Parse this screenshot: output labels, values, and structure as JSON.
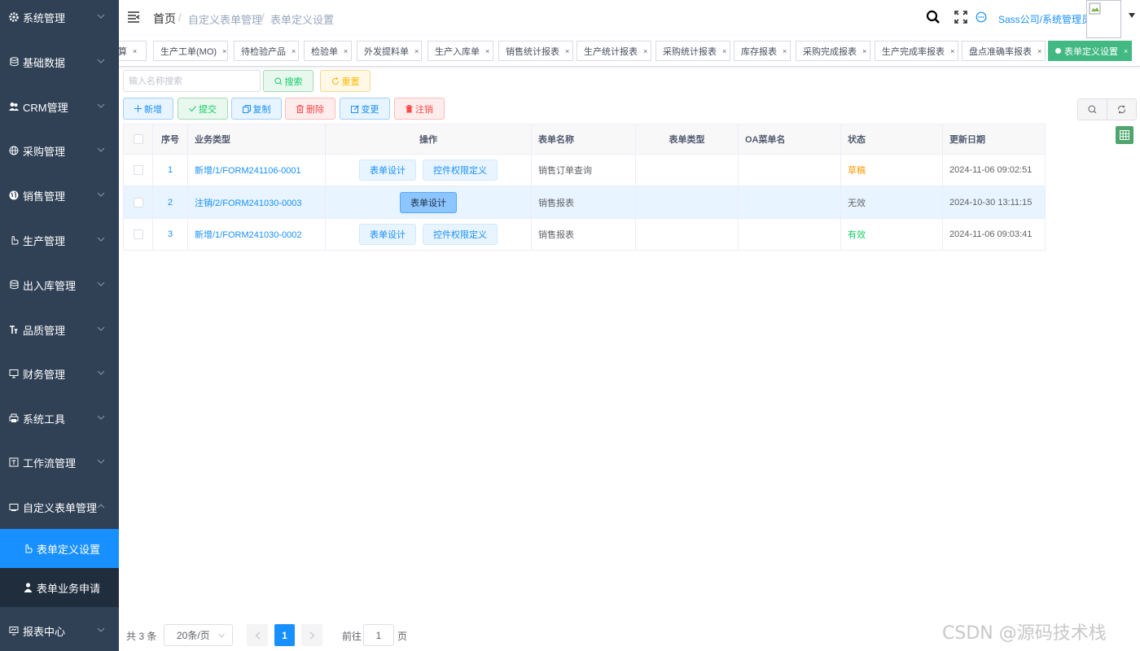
{
  "sidebar": {
    "items": [
      {
        "label": "系统管理",
        "icon": "gear-icon"
      },
      {
        "label": "基础数据",
        "icon": "database-icon"
      },
      {
        "label": "CRM管理",
        "icon": "user-group-icon"
      },
      {
        "label": "采购管理",
        "icon": "globe-icon"
      },
      {
        "label": "销售管理",
        "icon": "globe-filled-icon"
      },
      {
        "label": "生产管理",
        "icon": "hand-icon"
      },
      {
        "label": "出入库管理",
        "icon": "database-icon"
      },
      {
        "label": "品质管理",
        "icon": "text-size-icon"
      },
      {
        "label": "财务管理",
        "icon": "monitor-icon"
      },
      {
        "label": "系统工具",
        "icon": "printer-icon"
      },
      {
        "label": "工作流管理",
        "icon": "workflow-icon"
      },
      {
        "label": "自定义表单管理",
        "icon": "form-icon"
      },
      {
        "label": "报表中心",
        "icon": "report-icon"
      }
    ],
    "sub_items": [
      {
        "label": "表单定义设置",
        "icon": "hand-icon"
      },
      {
        "label": "表单业务申请",
        "icon": "person-icon"
      }
    ]
  },
  "header": {
    "breadcrumb": [
      "首页",
      "自定义表单管理",
      "表单定义设置"
    ],
    "separator": "/",
    "user": "Sass公司/系统管理员"
  },
  "tags": [
    {
      "label": "算"
    },
    {
      "label": "生产工单(MO)"
    },
    {
      "label": "待检验产品"
    },
    {
      "label": "检验单"
    },
    {
      "label": "外发提料单"
    },
    {
      "label": "生产入库单"
    },
    {
      "label": "销售统计报表"
    },
    {
      "label": "生产统计报表"
    },
    {
      "label": "采购统计报表"
    },
    {
      "label": "库存报表"
    },
    {
      "label": "采购完成报表"
    },
    {
      "label": "生产完成率报表"
    },
    {
      "label": "盘点准确率报表"
    },
    {
      "label": "表单定义设置",
      "active": true
    }
  ],
  "tag_close": "×",
  "search": {
    "placeholder": "输入名称搜索",
    "search_label": "搜索",
    "reset_label": "重置"
  },
  "toolbar": {
    "add": "新增",
    "submit": "提交",
    "copy": "复制",
    "delete": "删除",
    "change": "变更",
    "cancel": "注销"
  },
  "table": {
    "columns": [
      "序号",
      "业务类型",
      "操作",
      "表单名称",
      "表单类型",
      "OA菜单名",
      "状态",
      "更新日期"
    ],
    "op_design": "表单设计",
    "op_perm": "控件权限定义",
    "rows": [
      {
        "idx": "1",
        "biz": "新增/1/FORM241106-0001",
        "ops": [
          "表单设计",
          "控件权限定义"
        ],
        "name": "销售订单查询",
        "type": "",
        "oa": "",
        "status": "草稿",
        "status_color": "#ff9900",
        "date": "2024-11-06 09:02:51"
      },
      {
        "idx": "2",
        "biz": "注销/2/FORM241030-0003",
        "ops": [
          "表单设计"
        ],
        "name": "销售报表",
        "type": "",
        "oa": "",
        "status": "无效",
        "status_color": "#606266",
        "date": "2024-10-30 13:11:15"
      },
      {
        "idx": "3",
        "biz": "新增/1/FORM241030-0002",
        "ops": [
          "表单设计",
          "控件权限定义"
        ],
        "name": "销售报表",
        "type": "",
        "oa": "",
        "status": "有效",
        "status_color": "#13ce66",
        "date": "2024-11-06 09:03:41"
      }
    ]
  },
  "pagination": {
    "total": "共 3 条",
    "page_size": "20条/页",
    "current": "1",
    "goto_label": "前往",
    "goto_value": "1",
    "page_label": "页"
  },
  "watermark": "CSDN @源码技术栈",
  "colors": {
    "sidebar_bg": "#304156",
    "submenu_bg": "#1f2d3d",
    "accent": "#1890ff",
    "active_tag": "#42b983"
  }
}
